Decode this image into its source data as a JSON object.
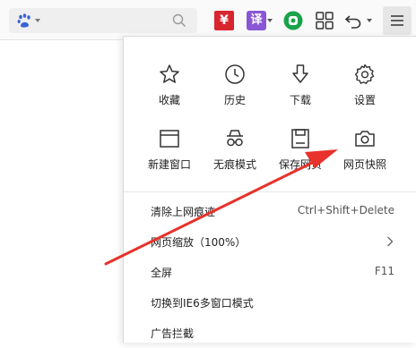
{
  "toolbar": {
    "engine_icon": "baidu-paw-icon",
    "search_icon": "search-icon",
    "extensions": [
      {
        "name": "yen-extension-icon",
        "glyph": "¥",
        "color": "#d8262f"
      },
      {
        "name": "translate-extension-icon",
        "glyph": "译",
        "color": "#8b56d6"
      },
      {
        "name": "green-extension-icon",
        "color": "#1aa34a"
      }
    ],
    "grid_icon": "apps-grid-icon",
    "undo_icon": "undo-icon",
    "menu_icon": "hamburger-menu-icon"
  },
  "menu": {
    "grid_items": [
      {
        "label": "收藏",
        "icon": "star-icon"
      },
      {
        "label": "历史",
        "icon": "clock-icon"
      },
      {
        "label": "下载",
        "icon": "download-icon"
      },
      {
        "label": "设置",
        "icon": "gear-icon"
      },
      {
        "label": "新建窗口",
        "icon": "window-icon"
      },
      {
        "label": "无痕模式",
        "icon": "incognito-icon"
      },
      {
        "label": "保存网页",
        "icon": "save-icon"
      },
      {
        "label": "网页快照",
        "icon": "camera-icon"
      }
    ],
    "list_items": [
      {
        "label": "清除上网痕迹",
        "shortcut": "Ctrl+Shift+Delete"
      },
      {
        "label": "网页缩放（100%）",
        "has_submenu": true
      },
      {
        "label": "全屏",
        "shortcut": "F11"
      },
      {
        "label": "切换到IE6多窗口模式",
        "shortcut": ""
      },
      {
        "label": "广告拦截",
        "shortcut": ""
      }
    ]
  },
  "annotation": {
    "arrow_color": "#e8322b"
  }
}
